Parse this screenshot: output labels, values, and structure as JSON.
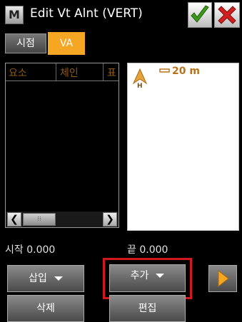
{
  "window": {
    "title": "Edit Vt Alnt (VERT)",
    "app_icon_letter": "M",
    "ok_icon": "checkmark-icon",
    "close_icon": "close-x-icon"
  },
  "tabs": [
    {
      "label": "시점",
      "active": false
    },
    {
      "label": "VA",
      "active": true
    }
  ],
  "list": {
    "columns": [
      "요소",
      "체인",
      "표"
    ],
    "rows": []
  },
  "graph": {
    "scale_label": "20 m",
    "marker_letter": "H"
  },
  "stations": {
    "start": "시작 0.000",
    "end": "끝 0.000"
  },
  "buttons": {
    "insert": "삽입",
    "add": "추가",
    "delete": "삭제",
    "edit": "편집"
  },
  "colors": {
    "accent": "#f5a623",
    "highlight": "#d0181e",
    "ok_green": "#3a9a1a",
    "close_red": "#d21f1f",
    "header_text": "#8a5a1a"
  }
}
